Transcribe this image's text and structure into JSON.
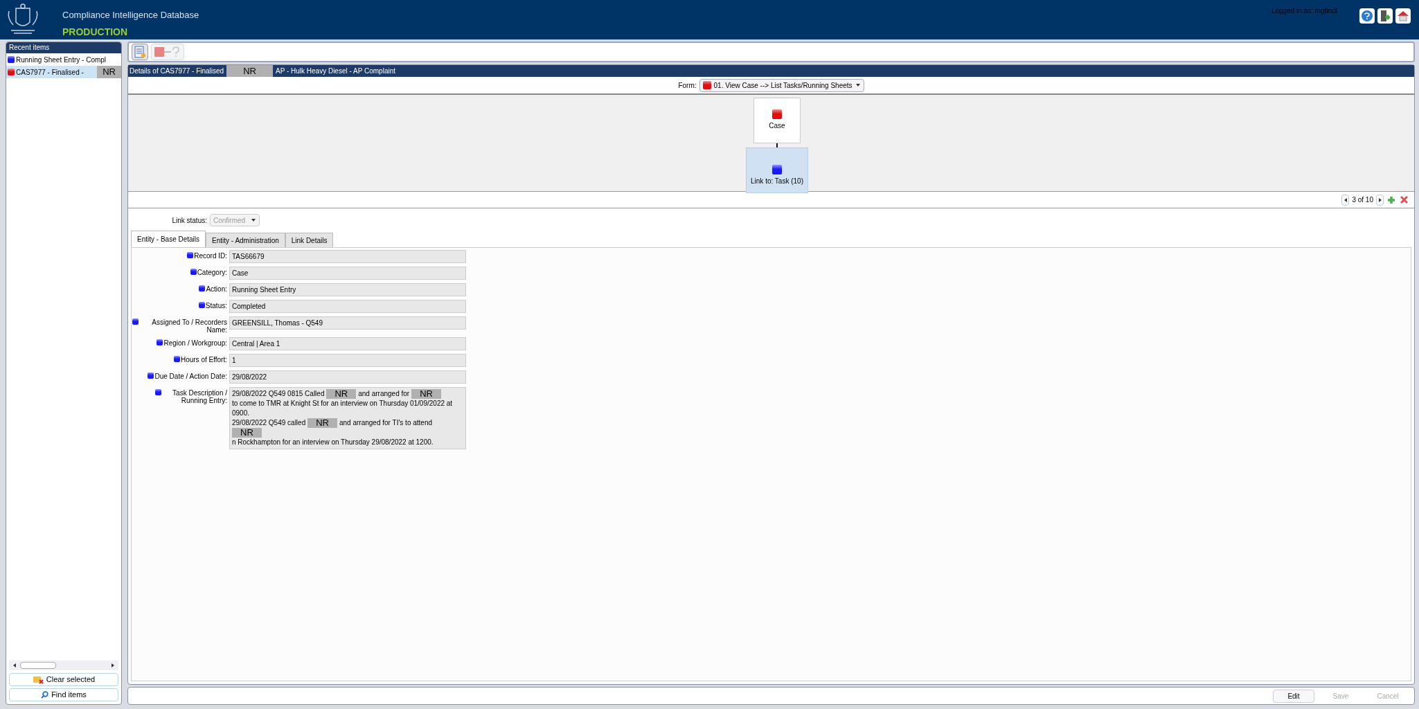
{
  "header": {
    "title": "Compliance Intelligence Database",
    "environment": "PRODUCTION",
    "login": "Logged in as: mgfindl"
  },
  "sidebar": {
    "title": "Recent items",
    "items": [
      {
        "label": "Running Sheet Entry - Compl",
        "color": "#1a1aff",
        "selected": false
      },
      {
        "label": "CAS7977 - Finalised -",
        "color": "#e01010",
        "selected": true,
        "redaction": "NR"
      }
    ],
    "buttons": [
      "Clear selected",
      "Find items"
    ]
  },
  "details_bar": {
    "parts": [
      {
        "kind": "text",
        "text": "Details of CAS7977 - Finalised"
      },
      {
        "kind": "redaction",
        "text": "NR"
      },
      {
        "kind": "text",
        "text": "AP - Hulk Heavy Diesel - AP Complaint"
      }
    ]
  },
  "form_selector": {
    "label": "Form:",
    "value": "01. View Case --> List Tasks/Running Sheets"
  },
  "diagram": {
    "nodes": [
      {
        "label": "Case",
        "color": "#e01010",
        "selected": false
      },
      {
        "label": "Link to: Task (10)",
        "color": "#1a1aff",
        "selected": true
      }
    ]
  },
  "pager": {
    "text": "3 of 10"
  },
  "link_status": {
    "label": "Link status:",
    "value": "Confirmed",
    "disabled": true
  },
  "tabs": [
    {
      "label": "Entity - Base Details",
      "selected": true
    },
    {
      "label": "Entity - Administration",
      "selected": false
    },
    {
      "label": "Link Details",
      "selected": false
    }
  ],
  "fields": [
    {
      "label": "Record ID:",
      "value": "TAS66679"
    },
    {
      "label": "Category:",
      "value": "Case"
    },
    {
      "label": "Action:",
      "value": "Running Sheet Entry"
    },
    {
      "label": "Status:",
      "value": "Completed"
    },
    {
      "label": "Assigned To / Recorders Name:",
      "value": "GREENSILL, Thomas - Q549"
    },
    {
      "label": "Region / Workgroup:",
      "value": "Central | Area 1"
    },
    {
      "label": "Hours of Effort:",
      "value": "1"
    },
    {
      "label": "Due Date / Action Date:",
      "value": "29/08/2022"
    }
  ],
  "description": {
    "label": "Task Description / Running Entry:",
    "paragraphs": [
      [
        {
          "kind": "text",
          "text": "29/08/2022 Q549 0815 Called"
        },
        {
          "kind": "redaction",
          "text": "NR"
        },
        {
          "kind": "text",
          "text": "and arranged for"
        },
        {
          "kind": "redaction",
          "text": "NR"
        },
        {
          "kind": "text",
          "text": "to come to TMR at Knight St for an interview on Thursday 01/09/2022 at 0900."
        }
      ],
      [
        {
          "kind": "text",
          "text": "29/08/2022 Q549 called"
        },
        {
          "kind": "redaction",
          "text": "NR"
        },
        {
          "kind": "text",
          "text": "and arranged for TI's to attend"
        },
        {
          "kind": "redaction",
          "text": "NR"
        },
        {
          "kind": "text",
          "text": "n Rockhampton for an interview on Thursday 29/08/2022 at 1200."
        }
      ]
    ]
  },
  "actions": [
    {
      "label": "Edit",
      "disabled": false
    },
    {
      "label": "Save",
      "disabled": true
    },
    {
      "label": "Cancel",
      "disabled": true
    }
  ]
}
